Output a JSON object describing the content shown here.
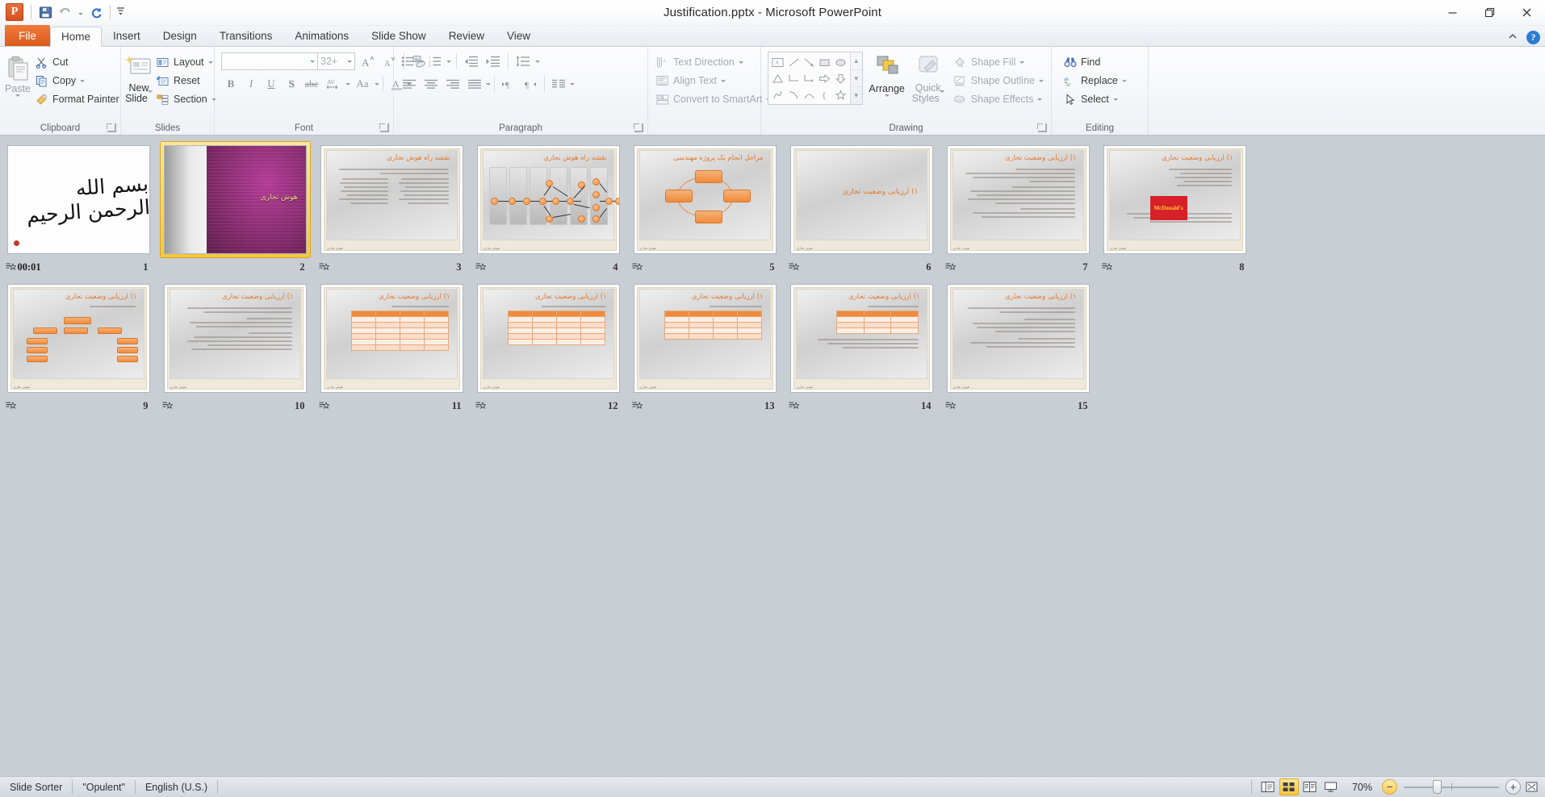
{
  "window": {
    "title": "Justification.pptx  -  Microsoft PowerPoint",
    "minimize": "—",
    "restore": "❐",
    "close": "✕"
  },
  "quick_access": {
    "logo": "P",
    "save": "save-icon",
    "undo": "undo-icon",
    "redo": "redo-icon",
    "customize": "customize-icon"
  },
  "tabs": [
    {
      "label": "File",
      "id": "file"
    },
    {
      "label": "Home",
      "id": "home",
      "active": true
    },
    {
      "label": "Insert",
      "id": "insert"
    },
    {
      "label": "Design",
      "id": "design"
    },
    {
      "label": "Transitions",
      "id": "transitions"
    },
    {
      "label": "Animations",
      "id": "animations"
    },
    {
      "label": "Slide Show",
      "id": "slide-show"
    },
    {
      "label": "Review",
      "id": "review"
    },
    {
      "label": "View",
      "id": "view"
    }
  ],
  "help": {
    "minimize_ribbon": "⌃",
    "help": "?"
  },
  "ribbon": {
    "clipboard": {
      "label": "Clipboard",
      "paste": "Paste",
      "cut": "Cut",
      "copy": "Copy",
      "format_painter": "Format Painter"
    },
    "slides": {
      "label": "Slides",
      "new_slide_line1": "New",
      "new_slide_line2": "Slide",
      "layout": "Layout",
      "reset": "Reset",
      "section": "Section"
    },
    "font": {
      "label": "Font",
      "font_name": "",
      "font_size": "32+",
      "bold": "B",
      "italic": "I",
      "underline": "U",
      "shadow": "S",
      "strikethrough": "abc",
      "char_spacing": "AV",
      "change_case": "Aa",
      "font_color": "A",
      "grow_font": "A",
      "shrink_font": "A",
      "clear_formatting": "clear-formatting-icon"
    },
    "paragraph": {
      "label": "Paragraph",
      "text_direction": "Text Direction",
      "align_text": "Align Text",
      "convert_to_smartart": "Convert to SmartArt"
    },
    "drawing": {
      "label": "Drawing",
      "arrange": "Arrange",
      "quick_styles_line1": "Quick",
      "quick_styles_line2": "Styles",
      "shape_fill": "Shape Fill",
      "shape_outline": "Shape Outline",
      "shape_effects": "Shape Effects"
    },
    "editing": {
      "label": "Editing",
      "find": "Find",
      "replace": "Replace",
      "select": "Select"
    }
  },
  "slides": [
    {
      "num": "1",
      "timing": "00:01",
      "kind": "bismillah",
      "title": "",
      "selected": false
    },
    {
      "num": "2",
      "timing": "",
      "kind": "purple-title",
      "title": "هوش تجاری",
      "selected": true
    },
    {
      "num": "3",
      "timing": "",
      "kind": "bullets",
      "title": "نقشه راه هوش تجاری",
      "selected": false
    },
    {
      "num": "4",
      "timing": "",
      "kind": "network",
      "title": "نقشه راه هوش تجاری",
      "selected": false
    },
    {
      "num": "5",
      "timing": "",
      "kind": "cycle",
      "title": "مراحل انجام یک پروژه مهندسی",
      "selected": false
    },
    {
      "num": "6",
      "timing": "",
      "kind": "section",
      "title": "۱) ارزیابی وضعیت تجاری",
      "selected": false
    },
    {
      "num": "7",
      "timing": "",
      "kind": "bullets",
      "title": "۱) ارزیابی وضعیت تجاری",
      "selected": false
    },
    {
      "num": "8",
      "timing": "",
      "kind": "mcdonalds",
      "title": "۱) ارزیابی وضعیت تجاری",
      "selected": false
    },
    {
      "num": "9",
      "timing": "",
      "kind": "orgchart",
      "title": "۱) ارزیابی وضعیت تجاری",
      "selected": false
    },
    {
      "num": "10",
      "timing": "",
      "kind": "bullets",
      "title": "۱) ارزیابی وضعیت تجاری",
      "selected": false
    },
    {
      "num": "11",
      "timing": "",
      "kind": "table",
      "title": "۱) ارزیابی وضعیت تجاری",
      "selected": false
    },
    {
      "num": "12",
      "timing": "",
      "kind": "table",
      "title": "۱) ارزیابی وضعیت تجاری",
      "selected": false
    },
    {
      "num": "13",
      "timing": "",
      "kind": "table",
      "title": "۱) ارزیابی وضعیت تجاری",
      "selected": false
    },
    {
      "num": "14",
      "timing": "",
      "kind": "table",
      "title": "۱) ارزیابی وضعیت تجاری",
      "selected": false
    },
    {
      "num": "15",
      "timing": "",
      "kind": "bullets",
      "title": "۱) ارزیابی وضعیت تجاری",
      "selected": false
    }
  ],
  "slide_footer": "هوش تجاری",
  "mcdonalds_logo": "McDonald's",
  "statusbar": {
    "view_name": "Slide Sorter",
    "theme": "\"Opulent\"",
    "language": "English (U.S.)",
    "zoom_level": "70%",
    "views": [
      {
        "name": "normal-view-button",
        "glyph": "normal",
        "active": false
      },
      {
        "name": "slide-sorter-view-button",
        "glyph": "sorter",
        "active": true
      },
      {
        "name": "reading-view-button",
        "glyph": "reading",
        "active": false
      },
      {
        "name": "slide-show-button",
        "glyph": "show",
        "active": false
      }
    ],
    "zoom_out": "−",
    "zoom_in": "+",
    "fit_to_window": "fit-window-icon"
  },
  "colors": {
    "accent_orange": "#dc5a1c",
    "theme_orange": "#ef8b3c",
    "selection_yellow": "#f5c73d",
    "purple": "#8e2d74"
  }
}
